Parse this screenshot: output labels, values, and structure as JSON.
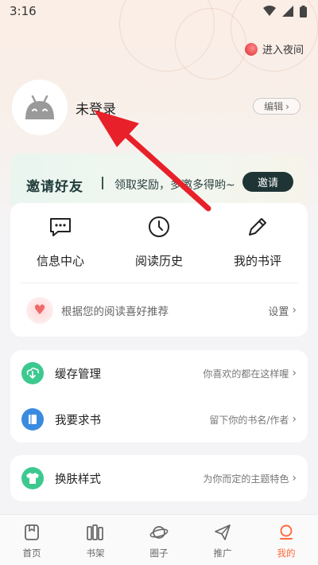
{
  "status_bar": {
    "time": "3:16"
  },
  "header": {
    "night_mode_label": "进入夜间"
  },
  "profile": {
    "login_label": "未登录",
    "edit_label": "编辑"
  },
  "invite": {
    "title": "邀请好友",
    "subtitle": "领取奖励，多邀多得哟~",
    "button_label": "邀请"
  },
  "quick_actions": [
    {
      "label": "信息中心",
      "icon": "message-icon"
    },
    {
      "label": "阅读历史",
      "icon": "clock-icon"
    },
    {
      "label": "我的书评",
      "icon": "pen-icon"
    }
  ],
  "recommend": {
    "text": "根据您的阅读喜好推荐",
    "setting_label": "设置"
  },
  "list_group_1": [
    {
      "title": "缓存管理",
      "hint": "你喜欢的都在这样喔",
      "icon": "download-icon",
      "color": "#3cc98f"
    },
    {
      "title": "我要求书",
      "hint": "留下你的书名/作者",
      "icon": "book-icon",
      "color": "#3a8be0"
    }
  ],
  "list_group_2": [
    {
      "title": "换肤样式",
      "hint": "为你而定的主题特色",
      "icon": "shirt-icon",
      "color": "#3cc98f"
    }
  ],
  "bottom_nav": [
    {
      "label": "首页",
      "icon": "home-icon",
      "active": false
    },
    {
      "label": "书架",
      "icon": "bookshelf-icon",
      "active": false
    },
    {
      "label": "圈子",
      "icon": "planet-icon",
      "active": false
    },
    {
      "label": "推广",
      "icon": "paper-plane-icon",
      "active": false
    },
    {
      "label": "我的",
      "icon": "profile-icon",
      "active": true
    }
  ],
  "colors": {
    "accent": "#ff6a3d",
    "arrow": "#e8202a",
    "invite_button": "#1f3535"
  }
}
